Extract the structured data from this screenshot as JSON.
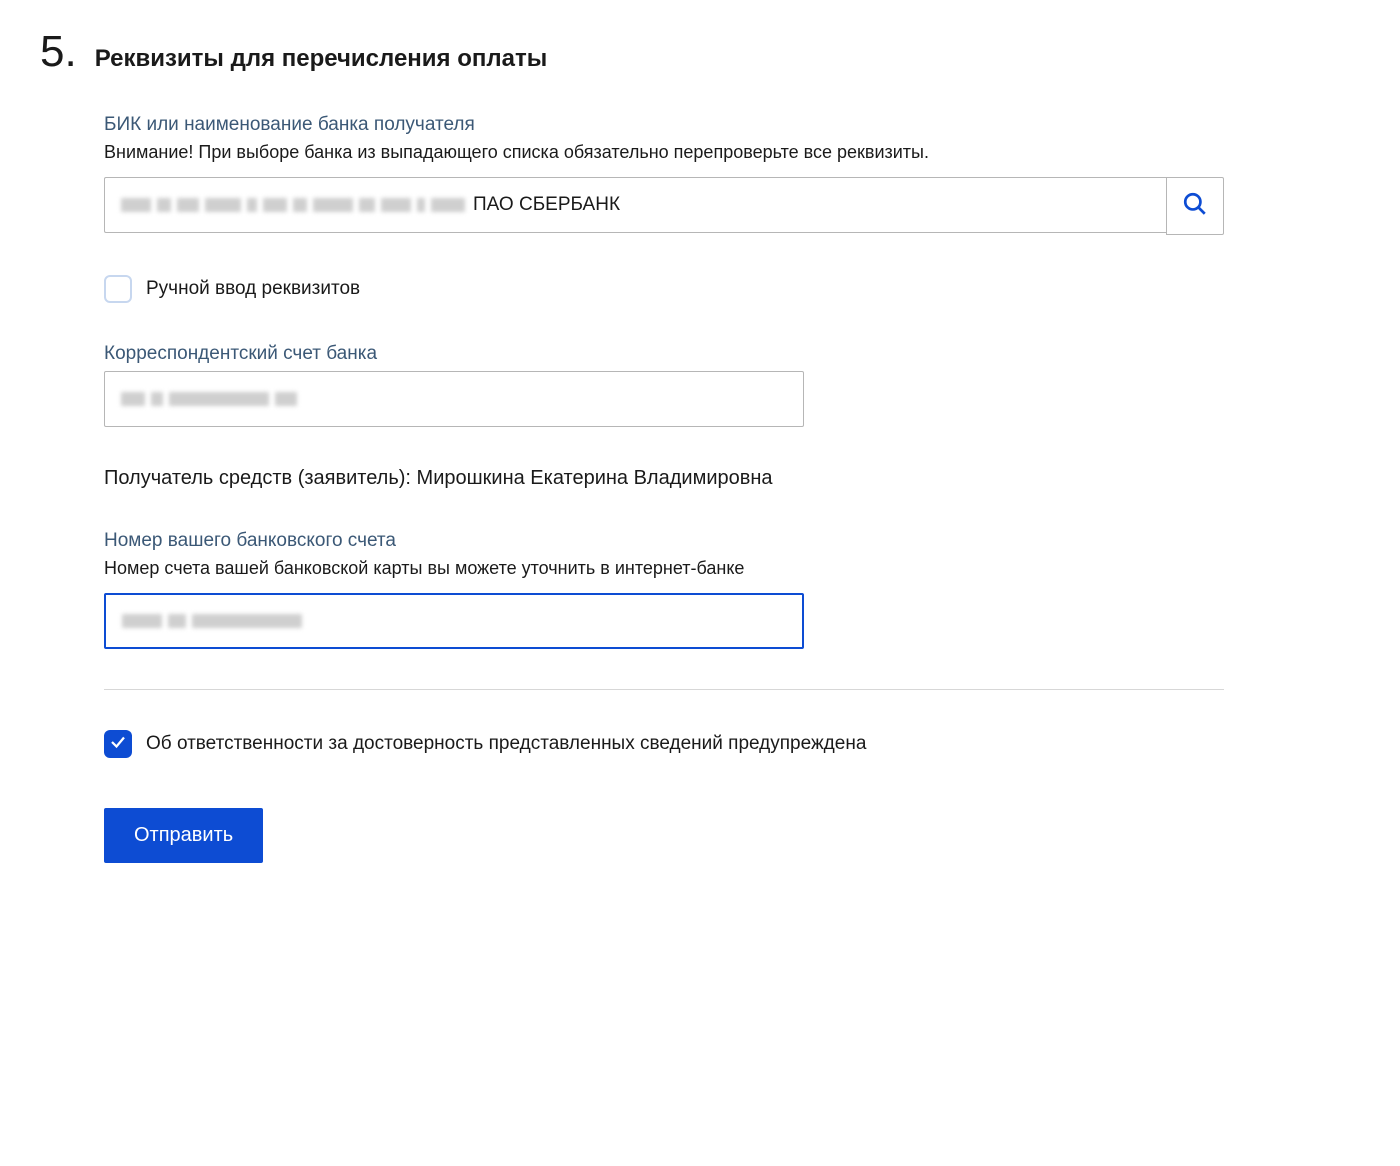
{
  "step": {
    "number": "5.",
    "title": "Реквизиты для перечисления оплаты"
  },
  "bank_field": {
    "label": "БИК или наименование банка получателя",
    "hint": "Внимание! При выборе банка из выпадающего списка обязательно перепроверьте все реквизиты.",
    "value_suffix": "ПАО СБЕРБАНК"
  },
  "manual_checkbox": {
    "label": "Ручной ввод реквизитов",
    "checked": false
  },
  "corr_account": {
    "label": "Корреспондентский счет банка"
  },
  "recipient": {
    "prefix": "Получатель средств (заявитель): ",
    "name": "Мирошкина Екатерина Владимировна"
  },
  "account_number": {
    "label": "Номер вашего банковского счета",
    "hint": "Номер счета вашей банковской карты вы можете уточнить в интернет-банке"
  },
  "confirm_checkbox": {
    "label": "Об ответственности за достоверность представленных сведений предупреждена",
    "checked": true
  },
  "submit": {
    "label": "Отправить"
  }
}
